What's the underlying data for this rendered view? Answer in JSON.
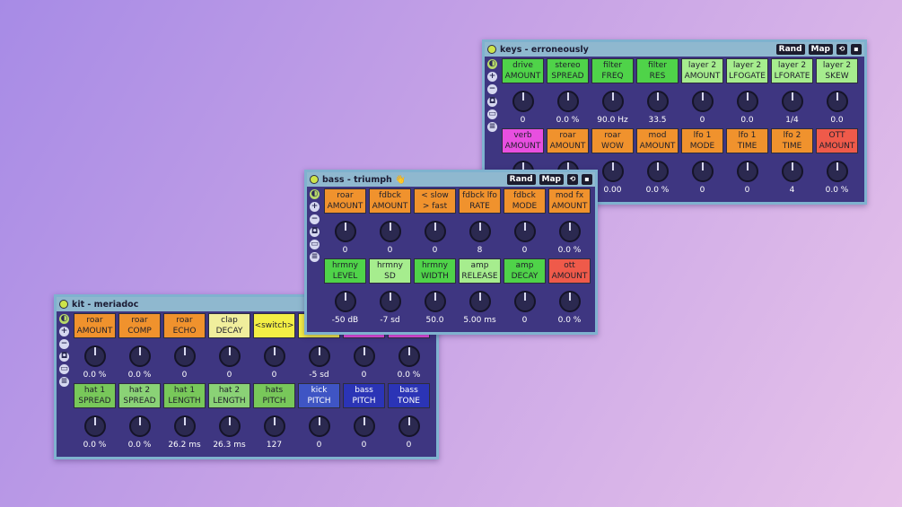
{
  "keys": {
    "title": "keys - erroneously",
    "rand": "Rand",
    "map": "Map",
    "macros": [
      {
        "l1": "drive",
        "l2": "AMOUNT",
        "val": "0",
        "color": "green"
      },
      {
        "l1": "stereo",
        "l2": "SPREAD",
        "val": "0.0 %",
        "color": "green"
      },
      {
        "l1": "filter",
        "l2": "FREQ",
        "val": "90.0 Hz",
        "color": "green"
      },
      {
        "l1": "filter",
        "l2": "RES",
        "val": "33.5",
        "color": "green"
      },
      {
        "l1": "layer 2",
        "l2": "AMOUNT",
        "val": "0",
        "color": "light"
      },
      {
        "l1": "layer 2",
        "l2": "LFOGATE",
        "val": "0.0",
        "color": "light"
      },
      {
        "l1": "layer 2",
        "l2": "LFORATE",
        "val": "1/4",
        "color": "light"
      },
      {
        "l1": "layer 2",
        "l2": "SKEW",
        "val": "0.0",
        "color": "light"
      },
      {
        "l1": "verb",
        "l2": "AMOUNT",
        "val": "",
        "color": "pink"
      },
      {
        "l1": "roar",
        "l2": "AMOUNT",
        "val": "",
        "color": "orange"
      },
      {
        "l1": "roar",
        "l2": "WOW",
        "val": "0.00",
        "color": "orange"
      },
      {
        "l1": "mod",
        "l2": "AMOUNT",
        "val": "0.0 %",
        "color": "orange"
      },
      {
        "l1": "lfo 1",
        "l2": "MODE",
        "val": "0",
        "color": "orange"
      },
      {
        "l1": "lfo 1",
        "l2": "TIME",
        "val": "0",
        "color": "orange"
      },
      {
        "l1": "lfo 2",
        "l2": "TIME",
        "val": "4",
        "color": "orange"
      },
      {
        "l1": "OTT",
        "l2": "AMOUNT",
        "val": "0.0 %",
        "color": "red"
      }
    ]
  },
  "bass": {
    "title": "bass - triumph 👋",
    "rand": "Rand",
    "map": "Map",
    "macros": [
      {
        "l1": "roar",
        "l2": "AMOUNT",
        "val": "0",
        "color": "orange"
      },
      {
        "l1": "fdbck",
        "l2": "AMOUNT",
        "val": "0",
        "color": "orange"
      },
      {
        "l1": "< slow",
        "l2": "> fast",
        "val": "0",
        "color": "orange"
      },
      {
        "l1": "fdbck lfo",
        "l2": "RATE",
        "val": "8",
        "color": "orange"
      },
      {
        "l1": "fdbck",
        "l2": "MODE",
        "val": "0",
        "color": "orange"
      },
      {
        "l1": "mod fx",
        "l2": "AMOUNT",
        "val": "0.0 %",
        "color": "orange"
      },
      {
        "l1": "hrmny",
        "l2": "LEVEL",
        "val": "-50 dB",
        "color": "green"
      },
      {
        "l1": "hrmny",
        "l2": "SD",
        "val": "-7 sd",
        "color": "light"
      },
      {
        "l1": "hrmny",
        "l2": "WIDTH",
        "val": "50.0",
        "color": "green"
      },
      {
        "l1": "amp",
        "l2": "RELEASE",
        "val": "5.00 ms",
        "color": "light"
      },
      {
        "l1": "amp",
        "l2": "DECAY",
        "val": "0",
        "color": "green"
      },
      {
        "l1": "ott",
        "l2": "AMOUNT",
        "val": "0.0 %",
        "color": "red"
      }
    ]
  },
  "kit": {
    "title": "kit - meriadoc",
    "macros": [
      {
        "l1": "roar",
        "l2": "AMOUNT",
        "val": "0.0 %",
        "color": "orange"
      },
      {
        "l1": "roar",
        "l2": "COMP",
        "val": "0.0 %",
        "color": "orange"
      },
      {
        "l1": "roar",
        "l2": "ECHO",
        "val": "0",
        "color": "orange"
      },
      {
        "l1": "clap",
        "l2": "DECAY",
        "val": "0",
        "color": "cream"
      },
      {
        "l1": "<switch>",
        "l2": "",
        "val": "0",
        "color": "yellow"
      },
      {
        "l1": "",
        "l2": "",
        "val": "-5 sd",
        "color": "yellow"
      },
      {
        "l1": "",
        "l2": "",
        "val": "0",
        "color": "pink"
      },
      {
        "l1": "",
        "l2": "",
        "val": "0.0 %",
        "color": "pink"
      },
      {
        "l1": "hat 1",
        "l2": "SPREAD",
        "val": "0.0 %",
        "color": "lgreen2"
      },
      {
        "l1": "hat 2",
        "l2": "SPREAD",
        "val": "0.0 %",
        "color": "lgreen"
      },
      {
        "l1": "hat 1",
        "l2": "LENGTH",
        "val": "26.2 ms",
        "color": "lgreen2"
      },
      {
        "l1": "hat 2",
        "l2": "LENGTH",
        "val": "26.3 ms",
        "color": "lgreen"
      },
      {
        "l1": "hats",
        "l2": "PITCH",
        "val": "127",
        "color": "lgreen2"
      },
      {
        "l1": "kick",
        "l2": "PITCH",
        "val": "0",
        "color": "blue"
      },
      {
        "l1": "bass",
        "l2": "PITCH",
        "val": "0",
        "color": "navy"
      },
      {
        "l1": "bass",
        "l2": "TONE",
        "val": "0",
        "color": "navy"
      }
    ]
  }
}
